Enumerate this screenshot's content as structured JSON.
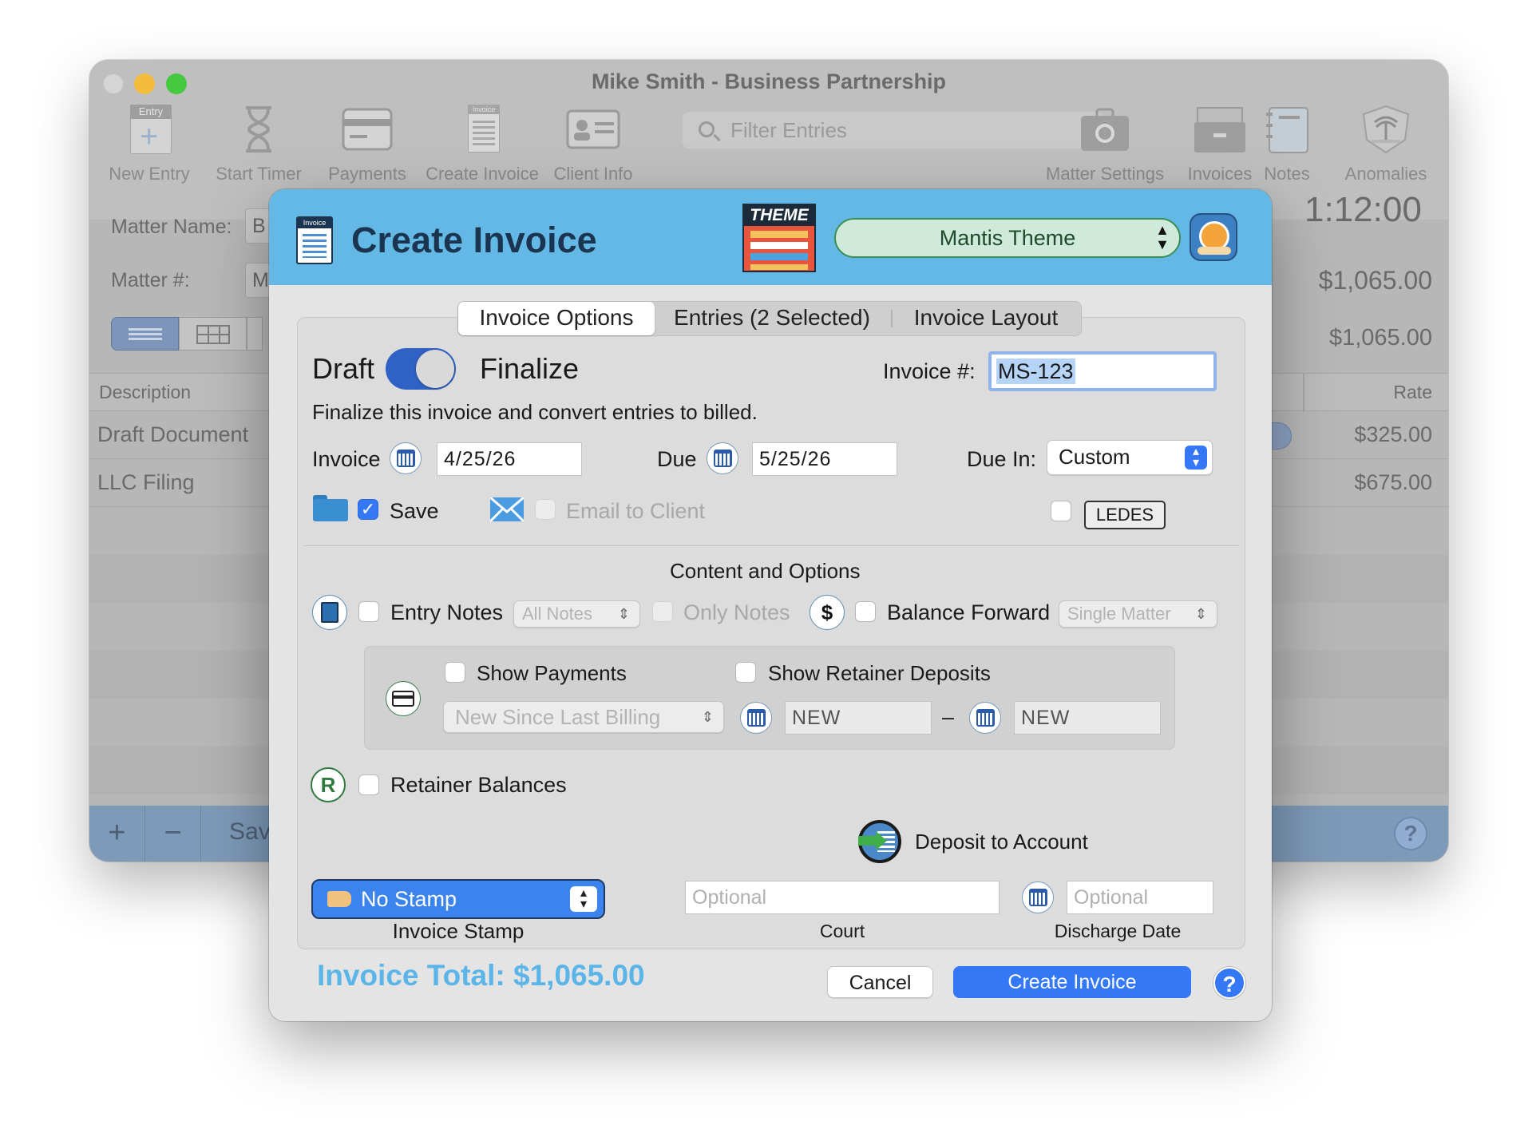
{
  "main_window": {
    "title": "Mike Smith - Business Partnership",
    "toolbar": {
      "new_entry": "New Entry",
      "new_entry_badge": "Entry",
      "start_timer": "Start Timer",
      "payments": "Payments",
      "create_invoice": "Create Invoice",
      "create_invoice_badge": "Invoice",
      "client_info": "Client Info",
      "filter_placeholder": "Filter Entries",
      "matter_settings": "Matter Settings",
      "invoices": "Invoices",
      "notes": "Notes",
      "anomalies": "Anomalies"
    },
    "matter_name_label": "Matter Name:",
    "matter_name_value": "B",
    "matter_num_label": "Matter #:",
    "matter_num_value": "M",
    "timer": "1:12:00",
    "amount_1": "$1,065.00",
    "amount_2": "$1,065.00",
    "table": {
      "col_description": "Description",
      "col_rate": "Rate",
      "rows": [
        {
          "description": "Draft Document",
          "rate": "$325.00"
        },
        {
          "description": "LLC Filing",
          "rate": "$675.00"
        }
      ]
    },
    "bottom_bar": {
      "add": "+",
      "remove": "−",
      "save_partial": "Sav"
    }
  },
  "dialog": {
    "title": "Create Invoice",
    "header_icon_badge": "Invoice",
    "theme_badge": "THEME",
    "theme_selected": "Mantis Theme",
    "tabs": [
      "Invoice Options",
      "Entries (2 Selected)",
      "Invoice Layout"
    ],
    "draft_label": "Draft",
    "finalize_label": "Finalize",
    "finalize_on": true,
    "invoice_num_label": "Invoice #:",
    "invoice_num_value": "MS-123",
    "finalize_desc": "Finalize this invoice and convert entries to billed.",
    "invoice_date_label": "Invoice",
    "invoice_date": "4/25/26",
    "due_label": "Due",
    "due_date": "5/25/26",
    "due_in_label": "Due In:",
    "due_in_value": "Custom",
    "save_label": "Save",
    "email_label": "Email to Client",
    "ledes_label": "LEDES",
    "content_heading": "Content and Options",
    "entry_notes_label": "Entry Notes",
    "notes_popup": "All Notes",
    "only_notes_label": "Only Notes",
    "balance_forward_label": "Balance Forward",
    "matter_scope_popup": "Single Matter",
    "show_payments_label": "Show Payments",
    "show_retainer_label": "Show Retainer Deposits",
    "payments_popup": "New Since Last Billing",
    "range_start": "NEW",
    "range_dash": "–",
    "range_end": "NEW",
    "retainer_balances_label": "Retainer Balances",
    "deposit_label": "Deposit to Account",
    "stamp_popup": "No Stamp",
    "stamp_caption": "Invoice Stamp",
    "court_placeholder": "Optional",
    "court_caption": "Court",
    "discharge_placeholder": "Optional",
    "discharge_caption": "Discharge Date",
    "total_label": "Invoice Total: $1,065.00",
    "cancel_label": "Cancel",
    "create_label": "Create Invoice",
    "help_label": "?",
    "dollar_symbol": "$",
    "retainer_symbol": "R"
  },
  "colors": {
    "header_blue": "#64b8e5",
    "accent_blue": "#3478f6",
    "total_blue": "#5cb5e8",
    "theme_green": "#cfe9da"
  }
}
